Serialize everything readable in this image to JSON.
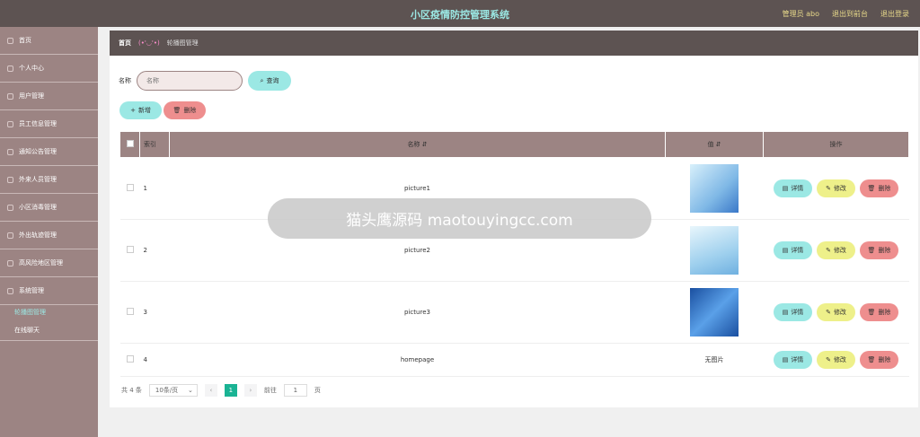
{
  "header": {
    "title": "小区疫情防控管理系统",
    "user": "管理员 abo",
    "backend": "退出到前台",
    "logout": "退出登录"
  },
  "sidebar": {
    "items": [
      {
        "label": "首页"
      },
      {
        "label": "个人中心"
      },
      {
        "label": "用户管理"
      },
      {
        "label": "员工信息管理"
      },
      {
        "label": "通知公告管理"
      },
      {
        "label": "外来人员管理"
      },
      {
        "label": "小区消毒管理"
      },
      {
        "label": "外出轨迹管理"
      },
      {
        "label": "高风险地区管理"
      },
      {
        "label": "系统管理"
      }
    ],
    "subitems": [
      {
        "label": "轮播图管理"
      },
      {
        "label": "在线聊天"
      }
    ]
  },
  "breadcrumb": {
    "home": "首页",
    "face": "(•'◡'•)",
    "current": "轮播图管理"
  },
  "search": {
    "label": "名称",
    "placeholder": "名称",
    "button": "查询"
  },
  "actions": {
    "add": "新增",
    "delete": "删除"
  },
  "table": {
    "headers": {
      "index": "索引",
      "name": "名称",
      "value": "值",
      "ops": "操作"
    },
    "rows": [
      {
        "index": "1",
        "name": "picture1",
        "value": ""
      },
      {
        "index": "2",
        "name": "picture2",
        "value": ""
      },
      {
        "index": "3",
        "name": "picture3",
        "value": ""
      },
      {
        "index": "4",
        "name": "homepage",
        "value": "无图片"
      }
    ],
    "ops": {
      "detail": "详情",
      "edit": "修改",
      "delete": "删除"
    }
  },
  "pager": {
    "total": "共 4 条",
    "size": "10条/页",
    "page": "1",
    "goto": "前往",
    "goto_val": "1",
    "unit": "页"
  },
  "watermark": "猫头鹰源码 maotouyingcc.com",
  "colors": {
    "brand": "#5d5352",
    "sidebar": "#9c8483",
    "accent": "#9be8e4",
    "danger": "#ee8e8e",
    "warning": "#eef08a",
    "pager_active": "#1ab394"
  }
}
